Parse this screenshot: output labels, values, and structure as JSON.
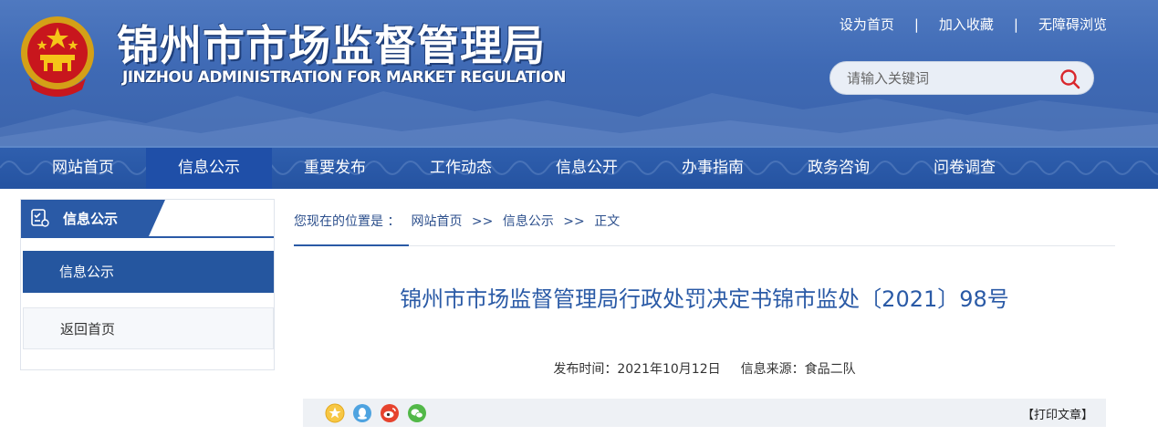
{
  "header": {
    "title_cn": "锦州市市场监督管理局",
    "title_en": "JINZHOU ADMINISTRATION FOR MARKET REGULATION",
    "toplinks": [
      "设为首页",
      "加入收藏",
      "无障碍浏览"
    ],
    "toplink_separator": "|",
    "search_placeholder": "请输入关键词"
  },
  "nav": {
    "items": [
      "网站首页",
      "信息公示",
      "重要发布",
      "工作动态",
      "信息公开",
      "办事指南",
      "政务咨询",
      "问卷调查"
    ],
    "active_index": 1
  },
  "sidebar": {
    "heading": "信息公示",
    "items": [
      "信息公示",
      "返回首页"
    ]
  },
  "breadcrumb": {
    "prefix": "您现在的位置是 ：",
    "items": [
      "网站首页",
      "信息公示",
      "正文"
    ],
    "separator": ">>"
  },
  "article": {
    "title": "锦州市市场监督管理局行政处罚决定书锦市监处〔2021〕98号",
    "publish_label": "发布时间：2021年10月12日",
    "source_label": "信息来源：食品二队"
  },
  "sharebar": {
    "print_label": "【打印文章】"
  },
  "colors": {
    "header_blue": "#3f6ab5",
    "nav_blue": "#2553a1",
    "accent_blue": "#2a5aa6"
  }
}
